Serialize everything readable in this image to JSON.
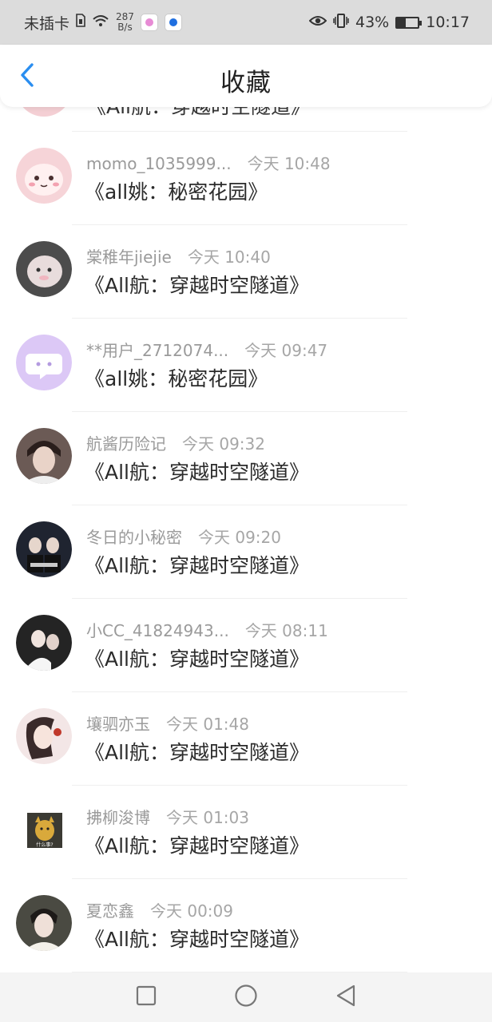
{
  "status_bar": {
    "carrier": "未插卡",
    "speed_value": "287",
    "speed_unit": "B/s",
    "battery": "43%",
    "time": "10:17"
  },
  "header": {
    "title": "收藏"
  },
  "partial_row": {
    "title": "《All航：穿越时空隧道》"
  },
  "items": [
    {
      "user": "momo_1035999...",
      "time": "今天 10:48",
      "title": "《all姚：秘密花园》",
      "avatar_color": "#f6d4d8"
    },
    {
      "user": "棠稚年jiejie",
      "time": "今天 10:40",
      "title": "《All航：穿越时空隧道》",
      "avatar_color": "#5a5a5a"
    },
    {
      "user": "**用户_2712074...",
      "time": "今天 09:47",
      "title": "《all姚：秘密花园》",
      "avatar_color": "#dcc8f6"
    },
    {
      "user": "航酱历险记",
      "time": "今天 09:32",
      "title": "《All航：穿越时空隧道》",
      "avatar_color": "#3b3130"
    },
    {
      "user": "冬日的小秘密",
      "time": "今天 09:20",
      "title": "《All航：穿越时空隧道》",
      "avatar_color": "#1f2430"
    },
    {
      "user": "小CC_41824943...",
      "time": "今天 08:11",
      "title": "《All航：穿越时空隧道》",
      "avatar_color": "#2a2a2a"
    },
    {
      "user": "壤驷亦玉",
      "time": "今天 01:48",
      "title": "《All航：穿越时空隧道》",
      "avatar_color": "#f1e1e1"
    },
    {
      "user": "拂柳浚博",
      "time": "今天 01:03",
      "title": "《All航：穿越时空隧道》",
      "avatar_color": "#5a4a2a"
    },
    {
      "user": "夏恋鑫",
      "time": "今天 00:09",
      "title": "《All航：穿越时空隧道》",
      "avatar_color": "#3a3a35"
    }
  ],
  "icons": {
    "back": "chevron-left-icon",
    "nav_recents": "square-icon",
    "nav_home": "circle-icon",
    "nav_back": "triangle-back-icon"
  },
  "colors": {
    "accent": "#2a8ef0",
    "status_bar_bg": "#dcdcdc"
  },
  "misc": {
    "cat_avatar_caption": "什么事?"
  }
}
